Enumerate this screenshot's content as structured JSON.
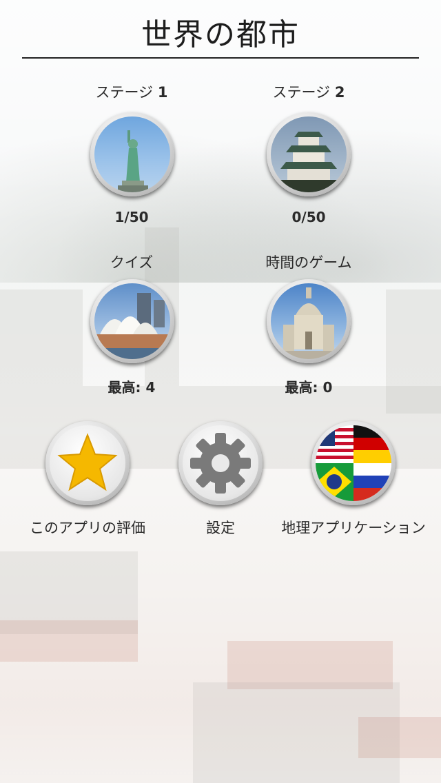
{
  "app": {
    "title": "世界の都市"
  },
  "stage1": {
    "label": "ステージ ",
    "num": "1",
    "progress": "1/50",
    "icon": "statue-of-liberty"
  },
  "stage2": {
    "label": "ステージ ",
    "num": "2",
    "progress": "0/50",
    "icon": "osaka-castle"
  },
  "quiz": {
    "label": "クイズ",
    "best_label": "最高: ",
    "best": "4",
    "icon": "sydney-opera-house"
  },
  "timed": {
    "label": "時間のゲーム",
    "best_label": "最高: ",
    "best": "0",
    "icon": "dresden-frauenkirche"
  },
  "bottom": {
    "rate": {
      "label": "このアプリの評価",
      "icon": "star-icon"
    },
    "settings": {
      "label": "設定",
      "icon": "gear-icon"
    },
    "geo": {
      "label": "地理アプリケーション",
      "icon": "flags-icon"
    }
  },
  "colors": {
    "star": "#f5b800",
    "gear": "#7a7a7a"
  }
}
